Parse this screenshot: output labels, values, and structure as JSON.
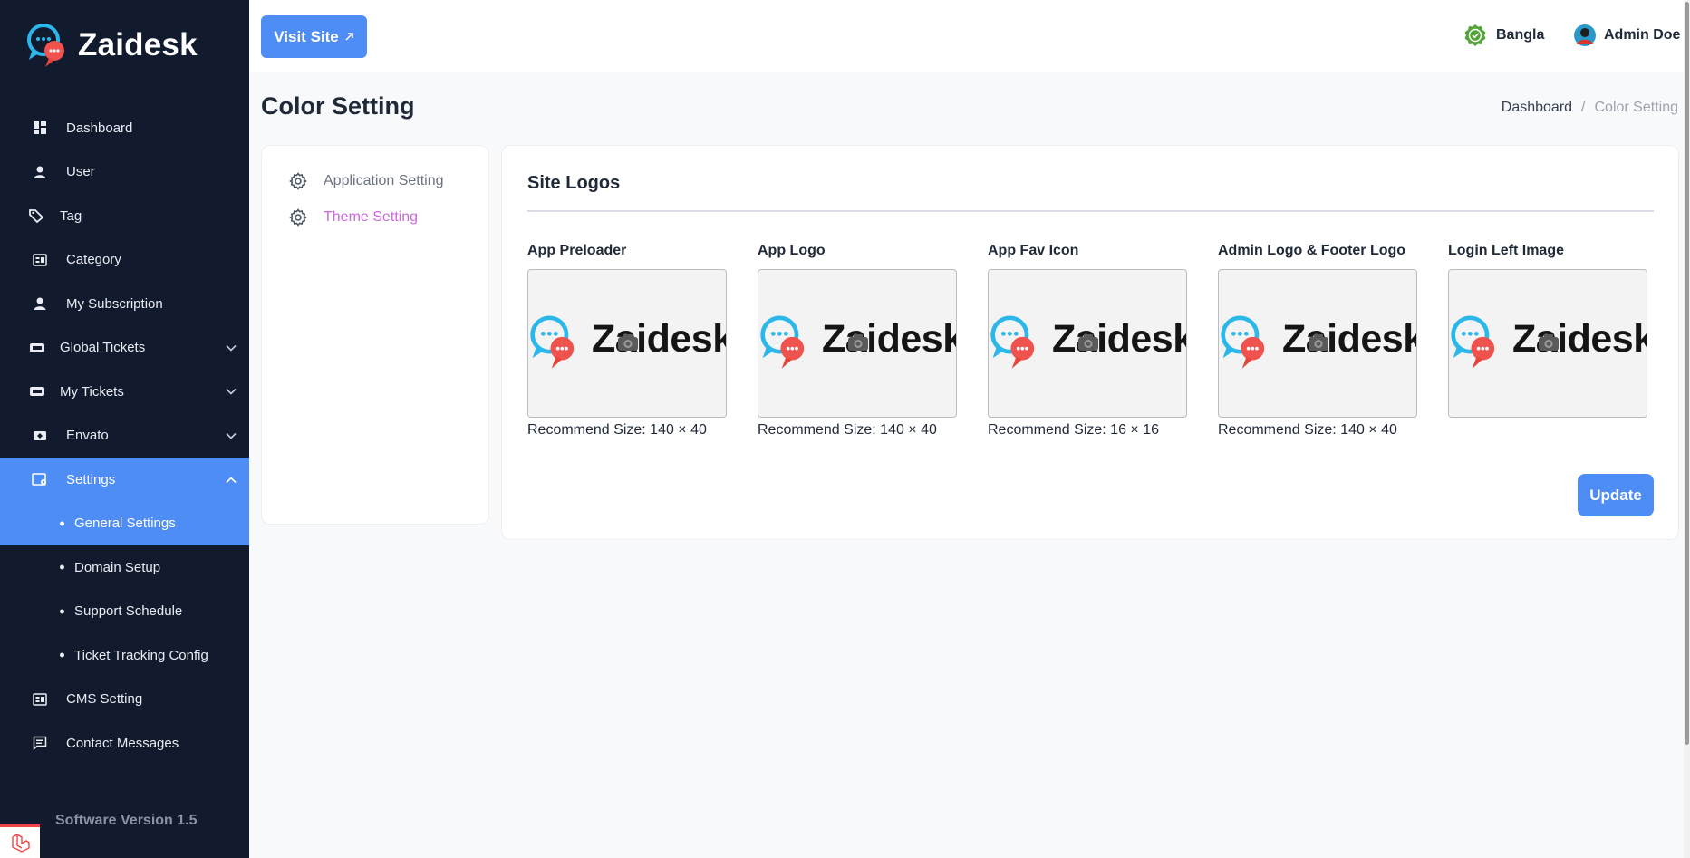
{
  "app": {
    "name": "Zaidesk",
    "version": "Software Version 1.5"
  },
  "colors": {
    "sidebar_bg": "#121a2d",
    "accent": "#4f8df6",
    "active_menu": "#c96ad9"
  },
  "sidebar": {
    "items": [
      {
        "label": "Dashboard",
        "icon": "dashboard-icon"
      },
      {
        "label": "User",
        "icon": "user-icon"
      },
      {
        "label": "Tag",
        "icon": "tag-icon"
      },
      {
        "label": "Category",
        "icon": "category-icon"
      },
      {
        "label": "My Subscription",
        "icon": "user-icon"
      },
      {
        "label": "Global Tickets",
        "icon": "ticket-icon",
        "expandable": true
      },
      {
        "label": "My Tickets",
        "icon": "ticket-icon",
        "expandable": true
      },
      {
        "label": "Envato",
        "icon": "envato-icon",
        "expandable": true
      },
      {
        "label": "Settings",
        "icon": "settings-icon",
        "expanded": true
      },
      {
        "label": "CMS Setting",
        "icon": "cms-icon"
      },
      {
        "label": "Contact Messages",
        "icon": "message-icon"
      }
    ],
    "settings_sub": [
      {
        "label": "General Settings"
      },
      {
        "label": "Domain Setup"
      },
      {
        "label": "Support Schedule"
      },
      {
        "label": "Ticket Tracking Config"
      }
    ]
  },
  "topbar": {
    "visit_label": "Visit Site",
    "language": "Bangla",
    "user_name": "Admin Doe"
  },
  "page": {
    "title": "Color Setting",
    "breadcrumb": {
      "home": "Dashboard",
      "sep": "/",
      "current": "Color Setting"
    }
  },
  "settings_menu": {
    "items": [
      {
        "label": "Application Setting"
      },
      {
        "label": "Theme Setting"
      }
    ]
  },
  "logos": {
    "section_title": "Site Logos",
    "logo_word": "Zaidesk",
    "items": [
      {
        "label": "App Preloader",
        "size": "Recommend Size: 140 × 40"
      },
      {
        "label": "App Logo",
        "size": "Recommend Size: 140 × 40"
      },
      {
        "label": "App Fav Icon",
        "size": "Recommend Size: 16 × 16"
      },
      {
        "label": "Admin Logo & Footer Logo",
        "size": "Recommend Size: 140 × 40"
      },
      {
        "label": "Login Left Image",
        "size": ""
      }
    ],
    "update_label": "Update"
  }
}
